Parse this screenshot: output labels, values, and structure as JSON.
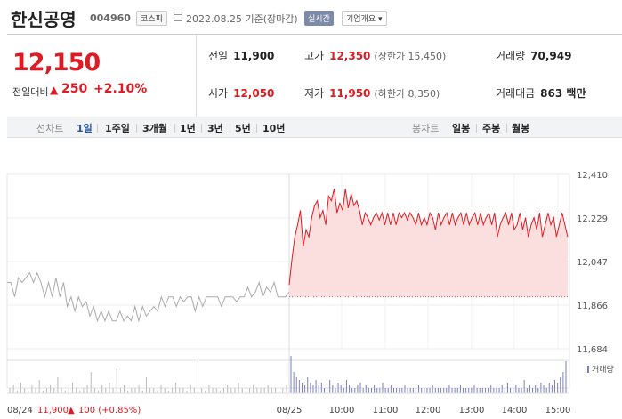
{
  "header": {
    "stock_name": "한신공영",
    "stock_code": "004960",
    "market": "코스피",
    "date_text": "2022.08.25  기준(장마감)",
    "realtime_label": "실시간",
    "company_button": "기업개요"
  },
  "summary": {
    "price": "12,150",
    "change_label": "전일대비",
    "change_arrow": "▲",
    "change_value": "250",
    "change_pct": "+2.10%",
    "prev_close_label": "전일",
    "prev_close": "11,900",
    "open_label": "시가",
    "open": "12,050",
    "high_label": "고가",
    "high": "12,350",
    "upper_limit": "(상한가 15,450)",
    "low_label": "저가",
    "low": "11,950",
    "lower_limit": "(하한가 8,350)",
    "volume_label": "거래량",
    "volume": "70,949",
    "amount_label": "거래대금",
    "amount": "863 백만"
  },
  "period_bar": {
    "line_label": "선차트",
    "line_periods": [
      "1일",
      "1주일",
      "3개월",
      "1년",
      "3년",
      "5년",
      "10년"
    ],
    "selected": "1일",
    "candle_label": "봉차트",
    "candle_periods": [
      "일봉",
      "주봉",
      "월봉"
    ]
  },
  "chart_data": {
    "type": "line",
    "y_ticks": [
      "12,410",
      "12,229",
      "12,047",
      "11,866",
      "11,684"
    ],
    "ylim": [
      11684,
      12410
    ],
    "x_ticks": [
      "08/25",
      "10:00",
      "11:00",
      "12:00",
      "13:00",
      "14:00",
      "15:00"
    ],
    "reference_price": 11900,
    "prev_day_label": "08/24",
    "prev_day_close": "11,900",
    "prev_day_arrow": "▲",
    "prev_day_change": "100 (+0.85%)",
    "volume_legend": "거래량",
    "colors": {
      "up": "#e01a22",
      "prev": "#aaaaaa",
      "fill": "#fbdede",
      "volume": "#7b7fc4"
    },
    "prev_series": [
      11960,
      11960,
      11900,
      11980,
      11960,
      11980,
      12000,
      11960,
      12000,
      11960,
      11900,
      11960,
      11900,
      11980,
      11900,
      11960,
      11860,
      11900,
      11840,
      11900,
      11860,
      11880,
      11820,
      11860,
      11800,
      11840,
      11800,
      11840,
      11800,
      11800,
      11840,
      11800,
      11820,
      11800,
      11860,
      11800,
      11860,
      11820,
      11840,
      11860,
      11840,
      11900,
      11860,
      11900,
      11900,
      11860,
      11900,
      11880,
      11900,
      11900,
      11840,
      11900,
      11860,
      11900,
      11900,
      11900,
      11900,
      11860,
      11900,
      11900,
      11900,
      11880,
      11900,
      11900,
      11940,
      11900,
      11920,
      11960,
      11900,
      11940,
      11920,
      11960,
      11900,
      11900,
      11900,
      11920
    ],
    "today_series": [
      11950,
      12060,
      12150,
      12200,
      12260,
      12110,
      12180,
      12150,
      12230,
      12280,
      12300,
      12230,
      12260,
      12200,
      12320,
      12300,
      12350,
      12250,
      12290,
      12260,
      12350,
      12270,
      12330,
      12280,
      12300,
      12260,
      12200,
      12250,
      12230,
      12200,
      12230,
      12250,
      12220,
      12250,
      12200,
      12250,
      12200,
      12250,
      12200,
      12250,
      12230,
      12250,
      12220,
      12250,
      12230,
      12200,
      12250,
      12200,
      12230,
      12200,
      12250,
      12230,
      12180,
      12250,
      12200,
      12230,
      12250,
      12200,
      12250,
      12200,
      12230,
      12250,
      12200,
      12250,
      12200,
      12230,
      12250,
      12200,
      12250,
      12200,
      12230,
      12250,
      12200,
      12250,
      12150,
      12200,
      12230,
      12250,
      12200,
      12250,
      12180,
      12200,
      12250,
      12180,
      12230,
      12150,
      12200,
      12230,
      12180,
      12250,
      12150,
      12200,
      12250,
      12200,
      12230,
      12150,
      12200,
      12250,
      12200,
      12150
    ],
    "prev_volume": [
      2,
      3,
      1,
      4,
      2,
      1,
      3,
      2,
      5,
      1,
      2,
      3,
      2,
      6,
      2,
      1,
      3,
      4,
      2,
      1,
      2,
      3,
      8,
      2,
      1,
      3,
      2,
      4,
      2,
      9,
      2,
      3,
      1,
      2,
      2,
      3,
      1,
      6,
      2,
      2,
      1,
      3,
      2,
      1,
      2,
      4,
      2,
      2,
      1,
      3,
      2,
      12,
      2,
      1,
      3,
      2,
      2,
      1,
      2,
      3,
      2,
      2,
      4,
      2,
      1,
      2,
      3,
      2,
      2,
      2,
      3,
      2,
      2,
      1,
      2,
      3
    ],
    "today_volume": [
      14,
      8,
      6,
      5,
      4,
      3,
      6,
      4,
      3,
      5,
      3,
      4,
      2,
      3,
      5,
      3,
      2,
      4,
      3,
      2,
      5,
      3,
      2,
      2,
      3,
      4,
      2,
      3,
      2,
      2,
      3,
      2,
      2,
      4,
      2,
      2,
      3,
      2,
      2,
      2,
      2,
      3,
      2,
      2,
      2,
      2,
      3,
      2,
      2,
      2,
      2,
      3,
      2,
      2,
      2,
      2,
      2,
      3,
      2,
      2,
      2,
      3,
      2,
      2,
      2,
      2,
      3,
      2,
      2,
      2,
      2,
      2,
      3,
      2,
      2,
      2,
      3,
      2,
      4,
      2,
      2,
      3,
      2,
      2,
      5,
      2,
      3,
      2,
      3,
      2,
      4,
      3,
      2,
      4,
      3,
      5,
      4,
      6,
      8,
      12
    ]
  }
}
